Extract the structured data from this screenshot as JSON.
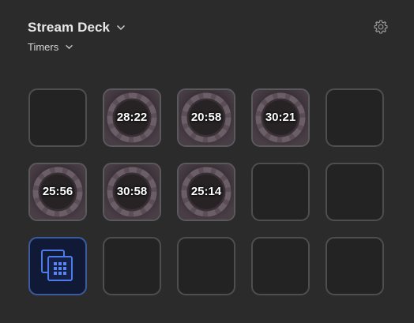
{
  "header": {
    "device_name": "Stream Deck",
    "profile_name": "Timers",
    "settings_icon": "gear-icon"
  },
  "keys": [
    {
      "type": "empty"
    },
    {
      "type": "timer",
      "time": "28:22"
    },
    {
      "type": "timer",
      "time": "20:58"
    },
    {
      "type": "timer",
      "time": "30:21"
    },
    {
      "type": "empty"
    },
    {
      "type": "timer",
      "time": "25:56"
    },
    {
      "type": "timer",
      "time": "30:58"
    },
    {
      "type": "timer",
      "time": "25:14"
    },
    {
      "type": "empty"
    },
    {
      "type": "empty"
    },
    {
      "type": "app",
      "icon": "multi-window-grid-icon"
    },
    {
      "type": "empty"
    },
    {
      "type": "empty"
    },
    {
      "type": "empty"
    },
    {
      "type": "empty"
    }
  ],
  "colors": {
    "background": "#2b2b2b",
    "key_border": "#4e4e4e",
    "app_key_accent": "#3d6fe0"
  }
}
